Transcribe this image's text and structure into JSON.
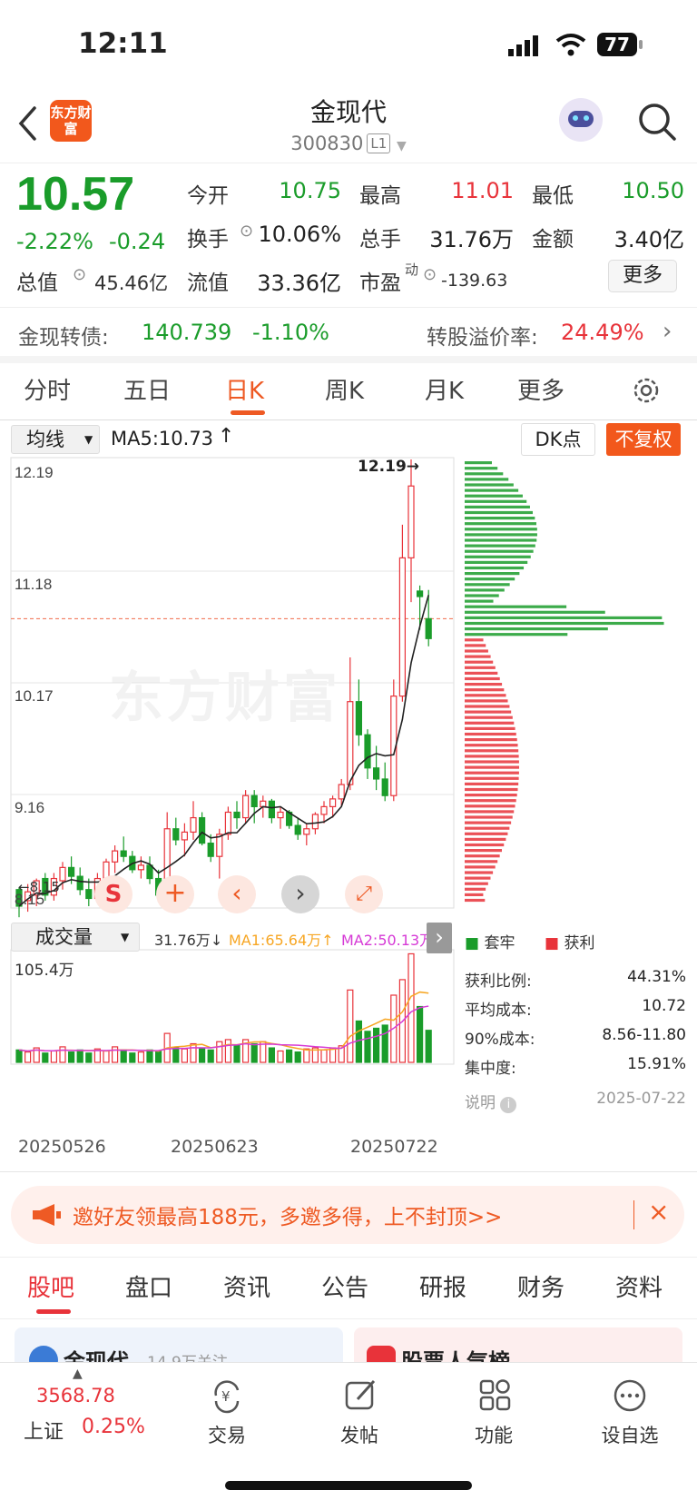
{
  "status": {
    "time": "12:11",
    "battery": "77"
  },
  "nav": {
    "title": "金现代",
    "code": "300830",
    "level": "L1",
    "logo": "东方财富"
  },
  "quote": {
    "price": "10.57",
    "change_pct": "-2.22%",
    "change": "-0.24",
    "total_value_label": "总值",
    "total_value": "45.46亿",
    "open_label": "今开",
    "open": "10.75",
    "high_label": "最高",
    "high": "11.01",
    "low_label": "最低",
    "low": "10.50",
    "turnover_label": "换手",
    "turnover": "10.06%",
    "volume_label": "总手",
    "volume": "31.76万",
    "amount_label": "金额",
    "amount": "3.40亿",
    "float_label": "流值",
    "float_value": "33.36亿",
    "pe_label": "市盈",
    "pe_sup": "动",
    "pe": "-139.63",
    "more_label": "更多"
  },
  "bond": {
    "label": "金现转债:",
    "price": "140.739",
    "pct": "-1.10%",
    "premium_label": "转股溢价率:",
    "premium": "24.49%"
  },
  "tabs": [
    "分时",
    "五日",
    "日K",
    "周K",
    "月K",
    "更多"
  ],
  "chart": {
    "ma_selector": "均线",
    "ma5": "MA5:10.73",
    "dk": "DK点",
    "fq": "不复权",
    "y_labels": [
      "12.19",
      "11.18",
      "10.17",
      "9.16",
      "8.15"
    ],
    "max_marker": "12.19",
    "watermark": "东方财富",
    "min_marker": "8.15",
    "vol_selector": "成交量",
    "vol_now": "31.76万",
    "vol_ma1": "MA1:65.64万",
    "vol_ma2": "MA2:50.13万",
    "vol_max": "105.4万",
    "dates": [
      "20250526",
      "20250623",
      "20250722"
    ],
    "legend_trapped": "套牢",
    "legend_profit": "获利",
    "colors": {
      "up": "#e8333a",
      "down": "#1a9c2a",
      "ma": "#222222",
      "ma1": "#f7a623",
      "ma2": "#d63ad6"
    }
  },
  "chip": {
    "profit_ratio_label": "获利比例:",
    "profit_ratio": "44.31%",
    "avg_cost_label": "平均成本:",
    "avg_cost": "10.72",
    "cost90_label": "90%成本:",
    "cost90": "8.56-11.80",
    "concentration_label": "集中度:",
    "concentration": "15.91%",
    "note_label": "说明",
    "date": "2025-07-22"
  },
  "banner": {
    "text": "邀好友领最高188元，多邀多得，上不封顶>>"
  },
  "bottom_tabs": [
    "股吧",
    "盘口",
    "资讯",
    "公告",
    "研报",
    "财务",
    "资料"
  ],
  "cards": {
    "left_title": "金现代",
    "left_sub": "14.9万关注",
    "right_title": "股票人气榜"
  },
  "footer": {
    "index_value": "3568.78",
    "index_name": "上证",
    "index_pct": "0.25%",
    "items": [
      "交易",
      "发帖",
      "功能",
      "设自选"
    ]
  }
}
